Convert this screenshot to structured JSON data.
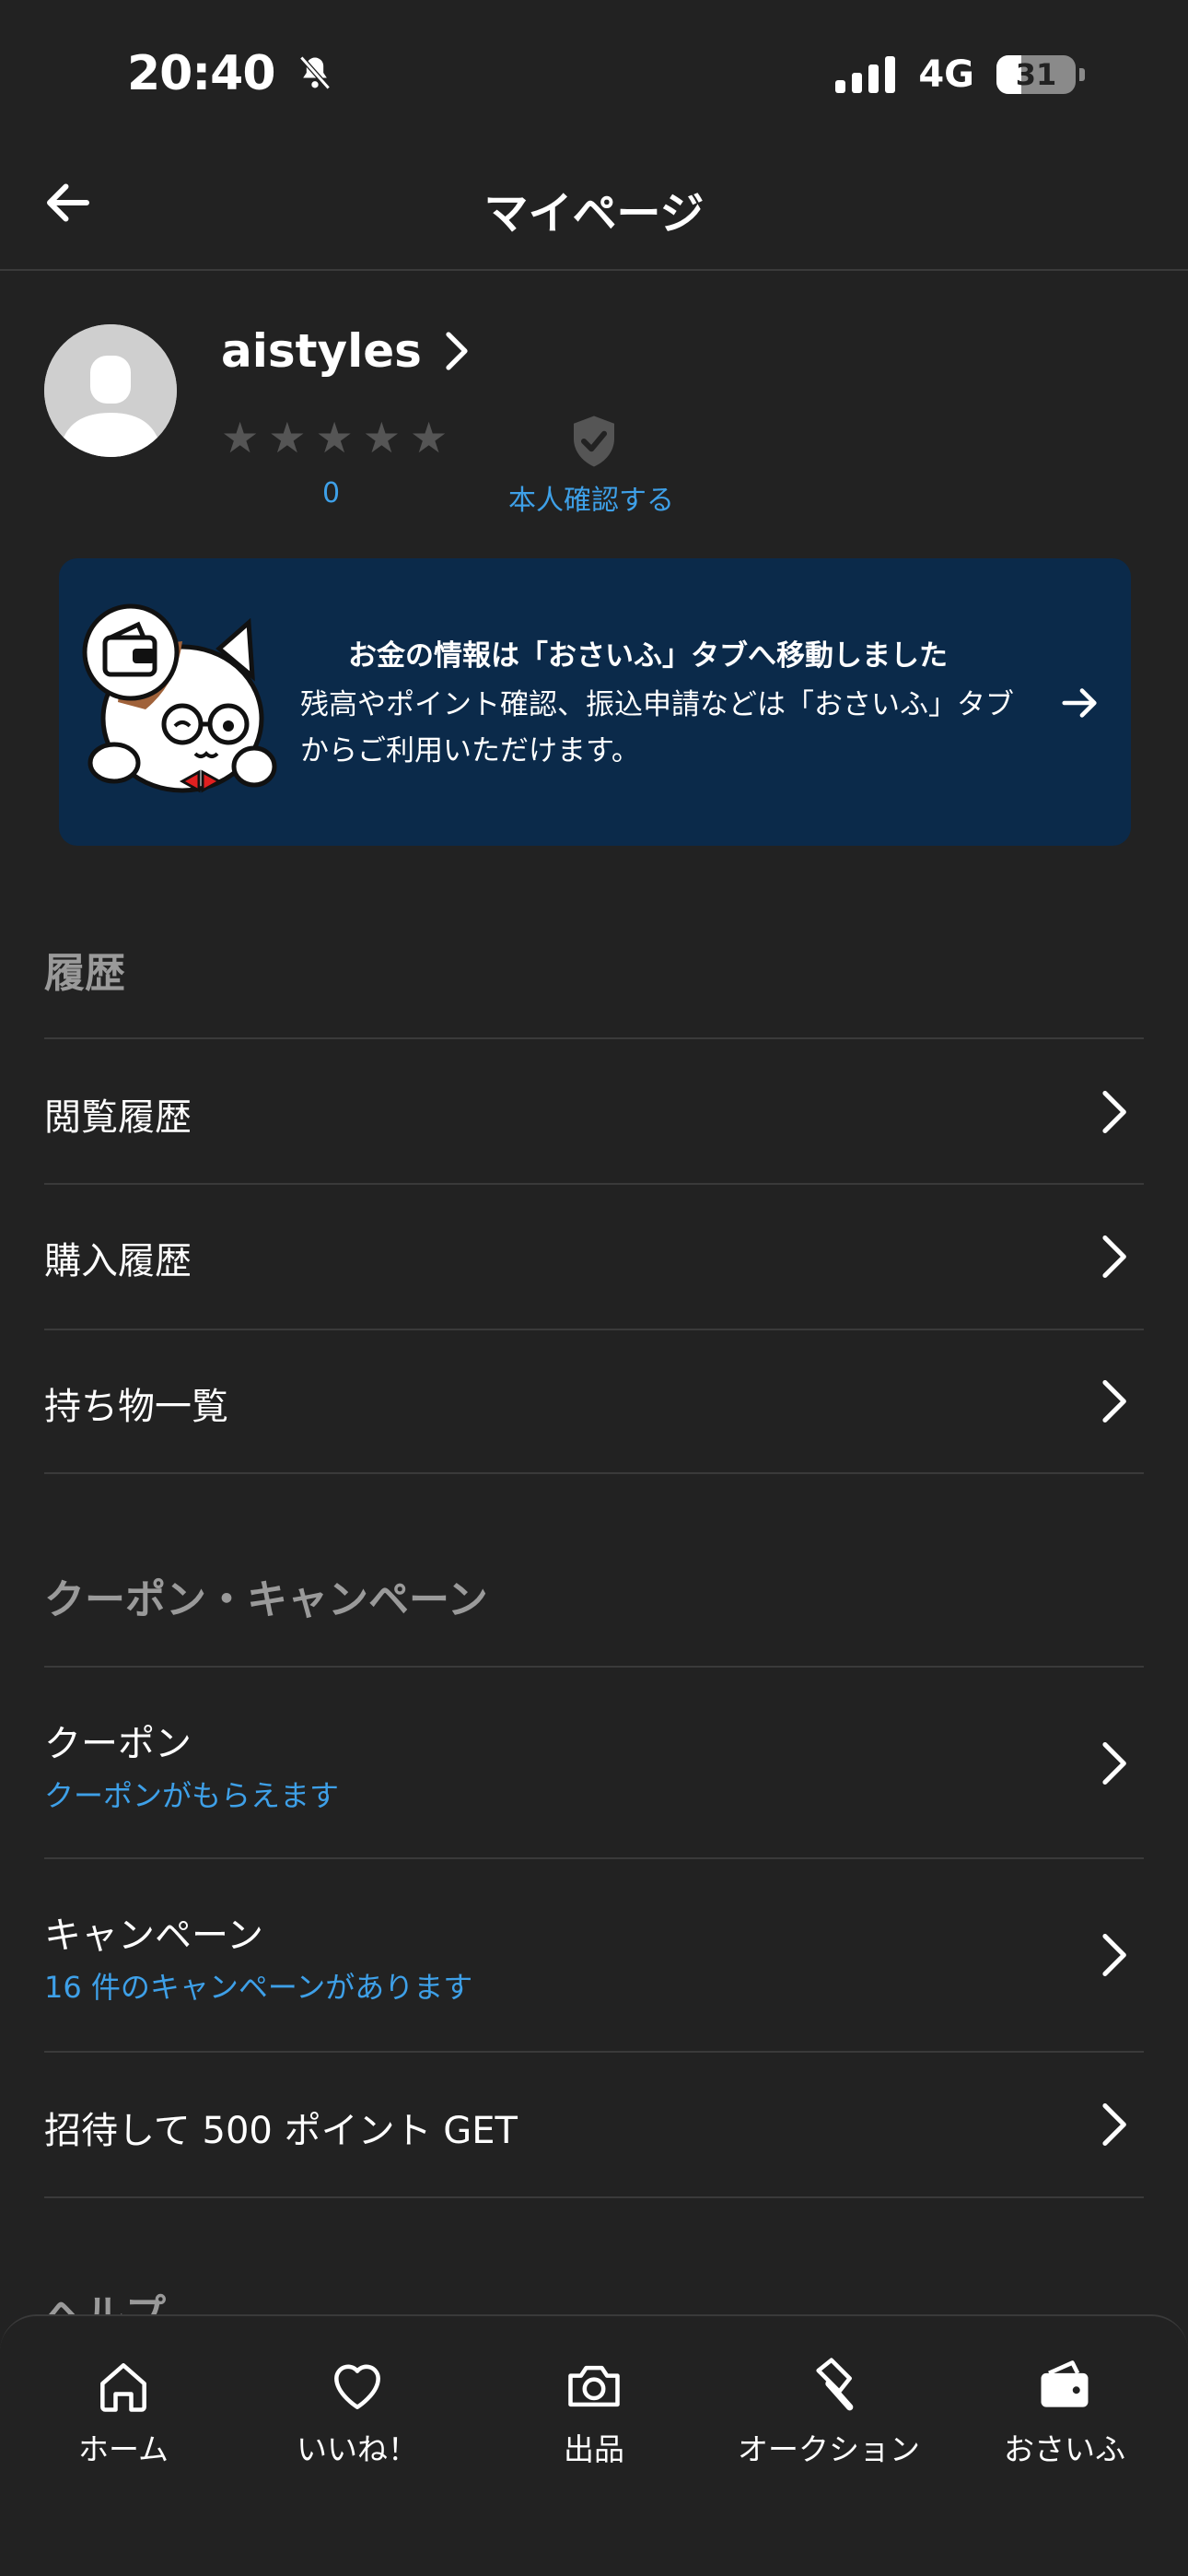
{
  "status_bar": {
    "time": "20:40",
    "network": "4G",
    "battery": "31",
    "battery_level": 0.31
  },
  "header": {
    "title": "マイページ",
    "back_icon": "arrow-left-icon"
  },
  "profile": {
    "username": "aistyles",
    "rating_count": "0",
    "rating_stars": 0,
    "verify_label": "本人確認する"
  },
  "banner": {
    "title": "お金の情報は「おさいふ」タブへ移動しました",
    "body": "残高やポイント確認、振込申請などは「おさいふ」タブからご利用いただけます。"
  },
  "history": {
    "title": "履歴",
    "items": [
      {
        "label": "閲覧履歴"
      },
      {
        "label": "購入履歴"
      },
      {
        "label": "持ち物一覧"
      }
    ]
  },
  "coupons": {
    "title": "クーポン・キャンペーン",
    "items": [
      {
        "label": "クーポン",
        "sub": "クーポンがもらえます"
      },
      {
        "label": "キャンペーン",
        "sub": "16 件のキャンペーンがあります"
      },
      {
        "label": "招待して 500 ポイント GET"
      }
    ]
  },
  "help": {
    "title": "ヘルプ"
  },
  "tabbar": {
    "tabs": [
      {
        "label": "ホーム",
        "icon": "home-icon"
      },
      {
        "label": "いいね！",
        "icon": "heart-icon"
      },
      {
        "label": "出品",
        "icon": "camera-icon"
      },
      {
        "label": "オークション",
        "icon": "gavel-icon"
      },
      {
        "label": "おさいふ",
        "icon": "wallet-icon"
      }
    ]
  },
  "colors": {
    "background": "#222222",
    "accent": "#3ea0e8",
    "banner": "#0b2a4a",
    "muted": "#9a9a9a"
  }
}
